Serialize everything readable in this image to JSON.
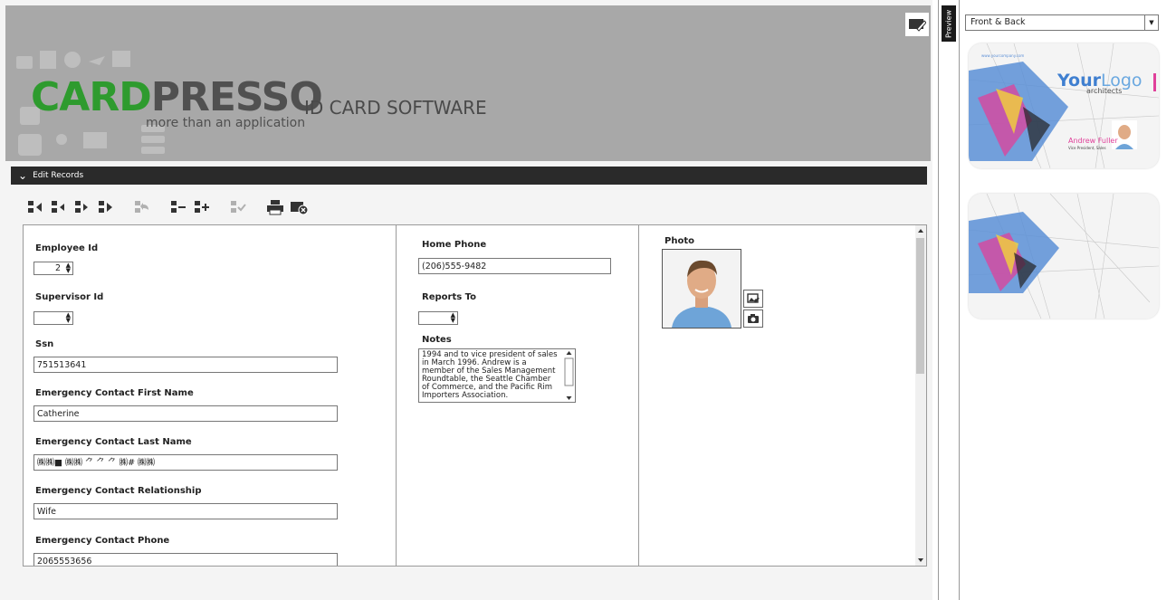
{
  "banner": {
    "logo_card": "CARD",
    "logo_presso": "PRESSO",
    "logo_tagline": "more than an application",
    "title": "ID CARD SOFTWARE"
  },
  "section": {
    "label": "Edit Records"
  },
  "toolbar": {
    "icons": [
      "first-record-icon",
      "previous-record-icon",
      "next-record-icon",
      "last-record-icon",
      "undo-record-icon",
      "delete-record-icon",
      "add-record-icon",
      "commit-record-icon",
      "print-icon",
      "close-card-icon"
    ]
  },
  "form": {
    "employee_id": {
      "label": "Employee Id",
      "value": "2"
    },
    "supervisor_id": {
      "label": "Supervisor Id",
      "value": ""
    },
    "ssn": {
      "label": "Ssn",
      "value": "751513641"
    },
    "ec_first": {
      "label": "Emergency Contact First Name",
      "value": "Catherine"
    },
    "ec_last": {
      "label": "Emergency Contact Last Name",
      "value": "㈱㈱■ ㈱㈱ ⺈ ⺈ ⺈ ㈱# ㈱㈱"
    },
    "ec_rel": {
      "label": "Emergency Contact Relationship",
      "value": "Wife"
    },
    "ec_phone": {
      "label": "Emergency Contact Phone",
      "value": "2065553656"
    },
    "home_phone": {
      "label": "Home Phone",
      "value": "(206)555-9482"
    },
    "reports_to": {
      "label": "Reports To",
      "value": ""
    },
    "notes": {
      "label": "Notes",
      "value": "1994 and to vice president of sales in March 1996.  Andrew is a member of the Sales Management Roundtable, the Seattle Chamber of Commerce, and the Pacific Rim Importers Association."
    },
    "photo": {
      "label": "Photo"
    }
  },
  "preview": {
    "tab_label": "Preview",
    "view_select": "Front & Back",
    "front": {
      "url": "www.yourcompany.com",
      "logo_your": "Your",
      "logo_logo": "Logo",
      "logo_sub": "architects",
      "name": "Andrew Fuller",
      "title": "Vice President, Sales"
    }
  },
  "colors": {
    "brand_green": "#2e9b2e",
    "accent_pink": "#e0409a",
    "header_dark": "#2a2a2a"
  }
}
